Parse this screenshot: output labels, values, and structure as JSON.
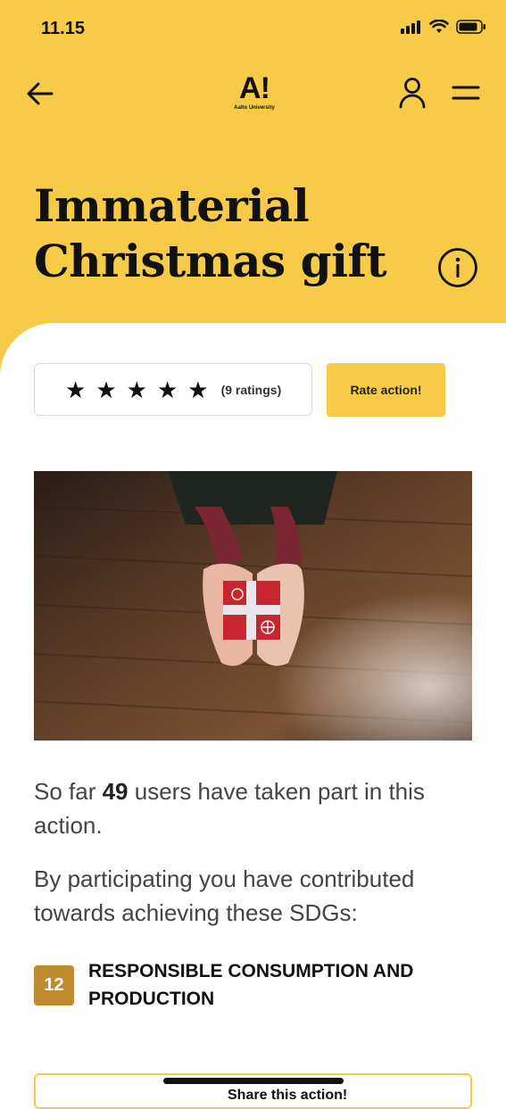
{
  "status_bar": {
    "time": "11.15"
  },
  "header": {
    "logo_mark": "A!",
    "logo_sub": "Aalto University",
    "title_line1": "Immaterial",
    "title_line2": "Christmas gift"
  },
  "rating": {
    "stars": 5,
    "count_text": "(9 ratings)",
    "rate_button": "Rate action!"
  },
  "participation": {
    "prefix": "So far ",
    "count": "49",
    "suffix": " users have taken part in this action."
  },
  "sdg_intro": "By participating you have contributed towards achieving these SDGs:",
  "sdgs": [
    {
      "number": "12",
      "label": "RESPONSIBLE CONSUMPTION AND PRODUCTION"
    }
  ],
  "bottom_button": {
    "label": "Share this action!"
  },
  "colors": {
    "accent": "#f7cb47",
    "sdg12": "#bf8b2e"
  },
  "icons": [
    "back-arrow-icon",
    "user-icon",
    "menu-icon",
    "info-icon",
    "star-icon",
    "signal-icon",
    "wifi-icon",
    "battery-icon"
  ]
}
